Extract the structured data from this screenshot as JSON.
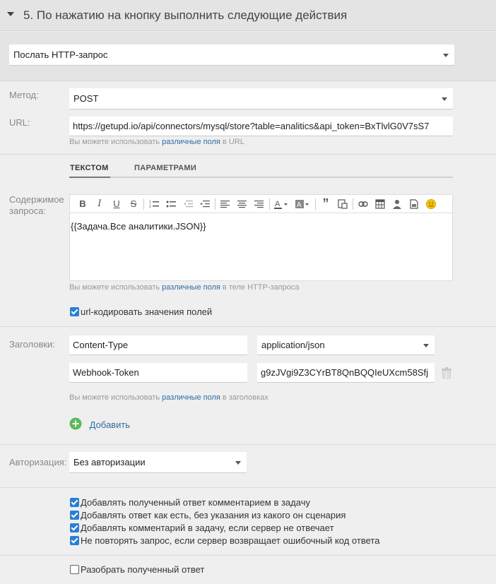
{
  "section": {
    "title": "5. По нажатию на кнопку выполнить следующие действия"
  },
  "action_select": {
    "value": "Послать HTTP-запрос"
  },
  "method": {
    "label": "Метод:",
    "value": "POST"
  },
  "url": {
    "label": "URL:",
    "value": "https://getupd.io/api/connectors/mysql/store?table=analitics&api_token=BxTlvlG0V7sS7",
    "hint_prefix": "Вы можете использовать",
    "hint_link": "различные поля",
    "hint_suffix": "в URL"
  },
  "body": {
    "label": "Содержимое запроса:",
    "tabs": [
      {
        "label": "ТЕКСТОМ"
      },
      {
        "label": "ПАРАМЕТРАМИ"
      }
    ],
    "content": "{{Задача.Все аналитики.JSON}}",
    "hint_prefix": "Вы можете использовать",
    "hint_link": "различные поля",
    "hint_suffix": "в теле HTTP-запроса",
    "urlencode_label": "url-кодировать значения полей"
  },
  "headers": {
    "label": "Заголовки:",
    "rows": [
      {
        "name": "Content-Type",
        "value": "application/json"
      },
      {
        "name": "Webhook-Token",
        "value": "g9zJVgi9Z3CYrBT8QnBQQIeUXcm58Sfj"
      }
    ],
    "hint_prefix": "Вы можете использовать",
    "hint_link": "различные поля",
    "hint_suffix": "в заголовках",
    "add_label": "Добавить"
  },
  "auth": {
    "label": "Авторизация:",
    "value": "Без авторизации"
  },
  "options": [
    {
      "label": "Добавлять полученный ответ комментарием в задачу",
      "checked": true
    },
    {
      "label": "Добавлять ответ как есть, без указания из какого он сценария",
      "checked": true
    },
    {
      "label": "Добавлять комментарий в задачу, если сервер не отвечает",
      "checked": true
    },
    {
      "label": "Не повторять запрос, если сервер возвращает ошибочный код ответа",
      "checked": true
    }
  ],
  "parse": {
    "label": "Разобрать полученный ответ",
    "checked": false
  },
  "colors": {
    "accent": "#2a7fd4",
    "link": "#2e6da4",
    "add_green": "#5cb85c"
  }
}
